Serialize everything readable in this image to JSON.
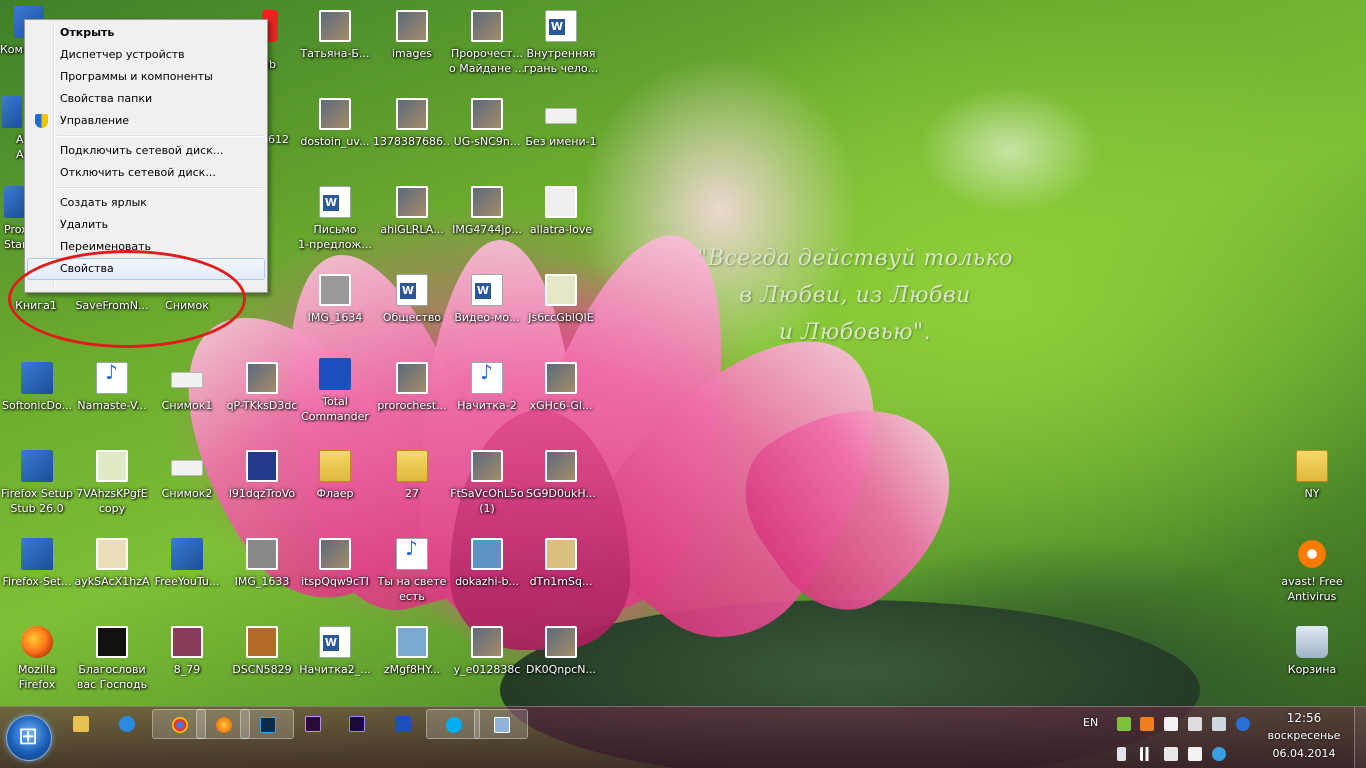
{
  "wallpaper": {
    "quote_lines": [
      "\"Всегда действуй только",
      "в Любви, из Любви",
      "и Любовью\"."
    ]
  },
  "context_menu": {
    "items": [
      {
        "label": "Открыть",
        "bold": true
      },
      {
        "label": "Диспетчер устройств"
      },
      {
        "label": "Программы и компоненты"
      },
      {
        "label": "Свойства папки"
      },
      {
        "label": "Управление",
        "icon": "uac-shield-icon"
      },
      {
        "label": "Подключить сетевой диск..."
      },
      {
        "label": "Отключить сетевой диск..."
      },
      {
        "label": "Создать ярлык"
      },
      {
        "label": "Удалить"
      },
      {
        "label": "Переименовать"
      },
      {
        "label": "Свойства",
        "highlighted": true
      }
    ]
  },
  "desktop_icons": [
    {
      "label": "Ком",
      "icon": "computer-icon"
    },
    {
      "label": "Татьяна-Б...",
      "icon": "photo-icon"
    },
    {
      "label": "images",
      "icon": "photo-icon"
    },
    {
      "label": "Пророчест...\nо Майдане ...",
      "icon": "photo-icon"
    },
    {
      "label": "Внутренняя\nгрань чело...",
      "icon": "word-doc-icon"
    },
    {
      "label": "ub",
      "icon": "app-icon"
    },
    {
      "label": "A\nA",
      "icon": "app-icon"
    },
    {
      "label": "612",
      "icon": "photo-icon"
    },
    {
      "label": "dostoin_uv...",
      "icon": "photo-icon"
    },
    {
      "label": "1378387686...",
      "icon": "photo-icon"
    },
    {
      "label": "UG-sNC9n...",
      "icon": "photo-icon"
    },
    {
      "label": "Без имени-1",
      "icon": "image-file-icon"
    },
    {
      "label": "Prox\nStar",
      "icon": "app-icon"
    },
    {
      "label": "Письмо\n1-предлож...",
      "icon": "word-doc-icon"
    },
    {
      "label": "ahiGLRLA...",
      "icon": "photo-icon"
    },
    {
      "label": "IMG4744jp...",
      "icon": "photo-icon"
    },
    {
      "label": "allatra-love",
      "icon": "photo-icon"
    },
    {
      "label": "Книга1",
      "icon": "excel-icon"
    },
    {
      "label": "SaveFromN...",
      "icon": "app-icon"
    },
    {
      "label": "Снимок",
      "icon": "image-file-icon"
    },
    {
      "label": "IMG_1634",
      "icon": "photo-icon"
    },
    {
      "label": "Общество",
      "icon": "word-doc-icon"
    },
    {
      "label": "Видео-мо...",
      "icon": "word-doc-icon"
    },
    {
      "label": "Js6ccGblQIE",
      "icon": "photo-icon"
    },
    {
      "label": "SoftonicDo...",
      "icon": "installer-icon"
    },
    {
      "label": "Namaste-V...",
      "icon": "mp3-file-icon"
    },
    {
      "label": "Снимок1",
      "icon": "image-file-icon"
    },
    {
      "label": "qP-TKksD3dc",
      "icon": "photo-icon"
    },
    {
      "label": "Total\nCommander",
      "icon": "floppy-icon"
    },
    {
      "label": "prorochest...",
      "icon": "photo-icon"
    },
    {
      "label": "Начитка-2",
      "icon": "wav-file-icon"
    },
    {
      "label": "xGHc6-Gl...",
      "icon": "photo-icon"
    },
    {
      "label": "Firefox Setup\nStub 26.0",
      "icon": "installer-icon"
    },
    {
      "label": "7VAhzsKPgfE\ncopy",
      "icon": "photo-icon"
    },
    {
      "label": "Снимок2",
      "icon": "image-file-icon"
    },
    {
      "label": "l91dqzTroVo",
      "icon": "photo-icon"
    },
    {
      "label": "Флаер",
      "icon": "folder-icon"
    },
    {
      "label": "27",
      "icon": "folder-icon"
    },
    {
      "label": "FtSaVcOhL5o\n(1)",
      "icon": "photo-icon"
    },
    {
      "label": "SG9D0ukH...",
      "icon": "photo-icon"
    },
    {
      "label": "NY",
      "icon": "folder-icon"
    },
    {
      "label": "Firefox-Set...",
      "icon": "installer-icon"
    },
    {
      "label": "aykSAcX1hzA",
      "icon": "photo-icon"
    },
    {
      "label": "FreeYouTu...",
      "icon": "app-icon"
    },
    {
      "label": "IMG_1633",
      "icon": "photo-icon"
    },
    {
      "label": "itspQqw9cTI",
      "icon": "photo-icon"
    },
    {
      "label": "Ты на свете\nесть",
      "icon": "mp3-file-icon"
    },
    {
      "label": "dokazhi-b...",
      "icon": "photo-icon"
    },
    {
      "label": "dTn1mSq...",
      "icon": "photo-icon"
    },
    {
      "label": "avast! Free\nAntivirus",
      "icon": "avast-icon"
    },
    {
      "label": "Mozilla\nFirefox",
      "icon": "firefox-icon"
    },
    {
      "label": "Благослови\nвас Господь",
      "icon": "video-file-icon"
    },
    {
      "label": "8_79",
      "icon": "photo-icon"
    },
    {
      "label": "DSCN5829",
      "icon": "photo-icon"
    },
    {
      "label": "Начитка2_...",
      "icon": "word-doc-icon"
    },
    {
      "label": "zMgf8HY...",
      "icon": "photo-icon"
    },
    {
      "label": "y_e012838c",
      "icon": "photo-icon"
    },
    {
      "label": "DK0QnpcN...",
      "icon": "photo-icon"
    },
    {
      "label": "Корзина",
      "icon": "recycle-bin-icon"
    }
  ],
  "taskbar": {
    "start_icon": "windows-start-icon",
    "apps": [
      "explorer-icon",
      "ie-icon",
      "chrome-icon",
      "firefox-icon",
      "photoshop-icon",
      "premiere-icon",
      "after-effects-icon",
      "total-commander-icon",
      "skype-icon",
      "app-window-icon"
    ],
    "active_apps": [
      2,
      3,
      4,
      8,
      9
    ],
    "tray": {
      "language": "EN",
      "time": "12:56",
      "day": "воскресенье",
      "date": "06.04.2014",
      "icons": [
        "tray-green-icon",
        "java-icon",
        "tray-doc-icon",
        "tray-sync-icon",
        "tray-network-icon",
        "bluetooth-icon",
        "battery-icon",
        "signal-icon",
        "volume-icon",
        "flag-icon",
        "tray-app-icon"
      ]
    }
  },
  "colors": {
    "highlight_border": "#a8c8ec",
    "ellipse": "#e31b1b"
  }
}
